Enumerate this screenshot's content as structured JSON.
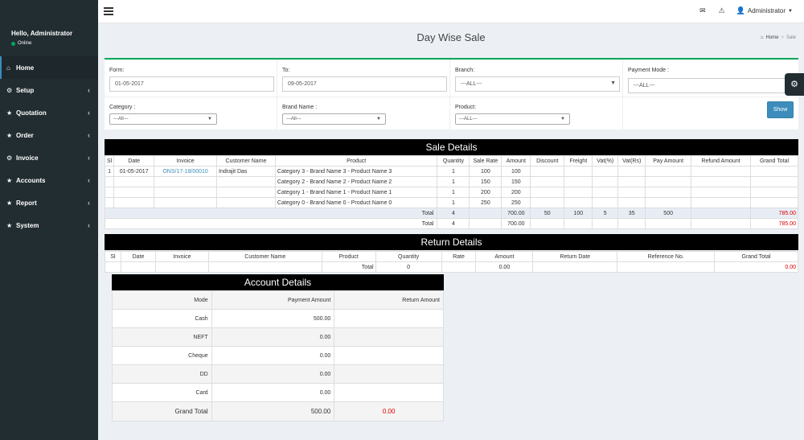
{
  "user": {
    "greeting": "Hello, Administrator",
    "status": "Online"
  },
  "sidebar": {
    "items": [
      {
        "label": "Home",
        "icon": "home-icon",
        "glyph": "⌂",
        "active": true,
        "has_children": false
      },
      {
        "label": "Setup",
        "icon": "cogs-icon",
        "glyph": "⚙",
        "active": false,
        "has_children": true
      },
      {
        "label": "Quotation",
        "icon": "star-icon",
        "glyph": "★",
        "active": false,
        "has_children": true
      },
      {
        "label": "Order",
        "icon": "star-icon",
        "glyph": "★",
        "active": false,
        "has_children": true
      },
      {
        "label": "Invoice",
        "icon": "cogs-icon",
        "glyph": "⚙",
        "active": false,
        "has_children": true
      },
      {
        "label": "Accounts",
        "icon": "star-icon",
        "glyph": "★",
        "active": false,
        "has_children": true
      },
      {
        "label": "Report",
        "icon": "star-icon",
        "glyph": "★",
        "active": false,
        "has_children": true
      },
      {
        "label": "System",
        "icon": "star-icon",
        "glyph": "★",
        "active": false,
        "has_children": true
      }
    ]
  },
  "topbar": {
    "admin_label": "Administrator",
    "icons": [
      "envelope-icon",
      "warning-icon",
      "user-icon"
    ]
  },
  "page": {
    "title": "Day Wise Sale"
  },
  "breadcrumb": {
    "home": "Home",
    "current": "Sale"
  },
  "filters": {
    "from_label": "Form:",
    "from_value": "01-05-2017",
    "to_label": "To:",
    "to_value": "09-05-2017",
    "branch_label": "Branch:",
    "branch_value": "---ALL---",
    "payment_label": "Payment Mode :",
    "payment_value": "---ALL---",
    "category_label": "Category :",
    "category_value": "---All---",
    "brand_label": "Brand Name :",
    "brand_value": "---All---",
    "product_label": "Product:",
    "product_value": "---ALL---",
    "show_label": "Show"
  },
  "sale": {
    "title": "Sale Details",
    "headers": [
      "Sl",
      "Date",
      "Invoice",
      "Customer Name",
      "Product",
      "Quantity",
      "Sale Rate",
      "Amount",
      "Discount",
      "Freight",
      "Vat(%)",
      "Vat(Rs)",
      "Pay Amount",
      "Refund Amount",
      "Grand Total"
    ],
    "rows": [
      {
        "sl": "1",
        "date": "01-05-2017",
        "invoice": "ONS/17-18/00010",
        "customer": "Indrajit Das",
        "product": "Category 3 - Brand Name 3 - Product Name 3",
        "qty": "1",
        "rate": "100",
        "amount": "100"
      },
      {
        "sl": "",
        "date": "",
        "invoice": "",
        "customer": "",
        "product": "Category 2 - Brand Name 2 - Product Name 2",
        "qty": "1",
        "rate": "150",
        "amount": "150"
      },
      {
        "sl": "",
        "date": "",
        "invoice": "",
        "customer": "",
        "product": "Category 1 - Brand Name 1 - Product Name 1",
        "qty": "1",
        "rate": "200",
        "amount": "200"
      },
      {
        "sl": "",
        "date": "",
        "invoice": "",
        "customer": "",
        "product": "Category 0 - Brand Name 0 - Product Name 0",
        "qty": "1",
        "rate": "250",
        "amount": "250"
      }
    ],
    "total1": {
      "label": "Total",
      "qty": "4",
      "amount": "700.00",
      "discount": "50",
      "freight": "100",
      "vat_pct": "5",
      "vat_rs": "35",
      "pay": "500",
      "refund": "",
      "grand": "785.00"
    },
    "total2": {
      "label": "Total",
      "qty": "4",
      "amount": "700.00",
      "grand": "785.00"
    }
  },
  "returns": {
    "title": "Return Details",
    "headers": [
      "Sl",
      "Date",
      "Invoice",
      "Customer Name",
      "Product",
      "Quantity",
      "Rate",
      "Amount",
      "Return Date",
      "Reference No.",
      "Grand Total"
    ],
    "total": {
      "label": "Total",
      "qty": "0",
      "amount": "0.00",
      "grand": "0.00"
    }
  },
  "account": {
    "title": "Account Details",
    "headers": [
      "Mode",
      "Payment Amount",
      "Return Amount"
    ],
    "rows": [
      {
        "mode": "Cash",
        "payment": "500.00",
        "ret": ""
      },
      {
        "mode": "NEFT",
        "payment": "0.00",
        "ret": ""
      },
      {
        "mode": "Cheque",
        "payment": "0.00",
        "ret": ""
      },
      {
        "mode": "DD",
        "payment": "0.00",
        "ret": ""
      },
      {
        "mode": "Card",
        "payment": "0.00",
        "ret": ""
      }
    ],
    "total": {
      "label": "Grand Total",
      "payment": "500.00",
      "ret": "0.00"
    }
  }
}
